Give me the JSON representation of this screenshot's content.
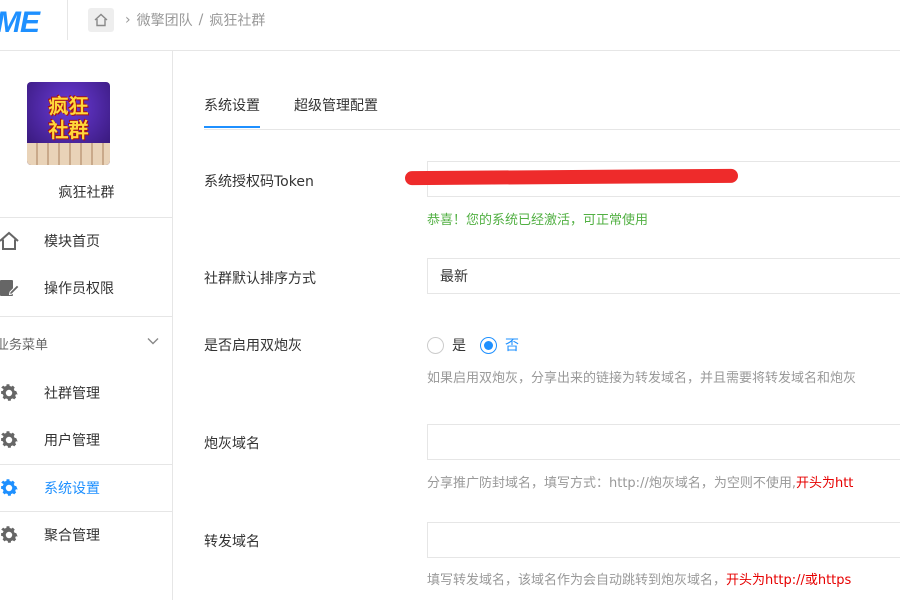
{
  "header": {
    "logo": "ME",
    "breadcrumb": [
      "微擎团队",
      "疯狂社群"
    ],
    "breadcrumb_sep": "/"
  },
  "sidebar": {
    "avatar_text": [
      "疯狂",
      "社群"
    ],
    "group_name": "疯狂社群",
    "top_items": [
      {
        "label": "模块首页",
        "icon": "home-icon"
      },
      {
        "label": "操作员权限",
        "icon": "operator-icon"
      }
    ],
    "menu_title": "业务菜单",
    "menu_items": [
      {
        "label": "社群管理",
        "icon": "gear-icon",
        "active": false
      },
      {
        "label": "用户管理",
        "icon": "gear-icon",
        "active": false
      },
      {
        "label": "系统设置",
        "icon": "gear-icon",
        "active": true
      },
      {
        "label": "聚合管理",
        "icon": "gear-icon",
        "active": false
      }
    ]
  },
  "tabs": [
    {
      "label": "系统设置",
      "active": true
    },
    {
      "label": "超级管理配置",
      "active": false
    }
  ],
  "form": {
    "token_label": "系统授权码Token",
    "token_value": "",
    "token_status": "恭喜！您的系统已经激活，可正常使用",
    "sort_label": "社群默认排序方式",
    "sort_value": "最新",
    "dual_label": "是否启用双炮灰",
    "dual_options": [
      "是",
      "否"
    ],
    "dual_selected": "否",
    "dual_hint": "如果启用双炮灰，分享出来的链接为转发域名，并且需要将转发域名和炮灰",
    "cannon_label": "炮灰域名",
    "cannon_value": "",
    "cannon_hint": "分享推广防封域名，填写方式：http://炮灰域名，为空则不使用,",
    "cannon_hint_red": "开头为htt",
    "forward_label": "转发域名",
    "forward_value": "",
    "forward_hint": "填写转发域名，该域名作为会自动跳转到炮灰域名，",
    "forward_hint_red": "开头为http://或https"
  },
  "colors": {
    "accent": "#1e90ff",
    "success": "#52b043",
    "warning_red": "#e60000"
  }
}
